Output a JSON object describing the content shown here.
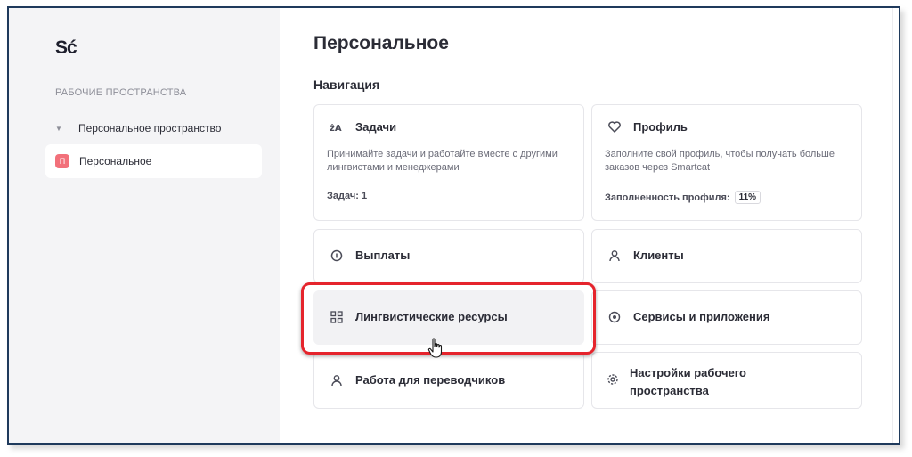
{
  "sidebar": {
    "logo": "Sć",
    "workspaces_header": "РАБОЧИЕ ПРОСТРАНСТВА",
    "group_label": "Персональное пространство",
    "group_caret": "▼",
    "active_item": {
      "badge": "П",
      "label": "Персональное"
    }
  },
  "main": {
    "title": "Персональное",
    "nav_heading": "Навигация",
    "cards": {
      "tasks": {
        "icon": "translate-icon",
        "title": "Задачи",
        "description": "Принимайте задачи и работайте вместе с другими лингвистами и менеджерами",
        "footer": "Задач: 1"
      },
      "profile": {
        "icon": "heart-icon",
        "title": "Профиль",
        "description": "Заполните свой профиль, чтобы получать больше заказов через Smartcat",
        "footer_label": "Заполненность профиля:",
        "footer_value": "11%"
      },
      "payouts": {
        "icon": "coin-icon",
        "title": "Выплаты"
      },
      "clients": {
        "icon": "user-icon",
        "title": "Клиенты"
      },
      "linguistic": {
        "icon": "grid-icon",
        "title": "Лингвистические ресурсы"
      },
      "services": {
        "icon": "target-icon",
        "title": "Сервисы и приложения"
      },
      "translators": {
        "icon": "user-icon",
        "title": "Работа для переводчиков"
      },
      "settings": {
        "icon": "gear-icon",
        "title": "Настройки рабочего пространства"
      }
    }
  },
  "colors": {
    "highlight": "#e5242c",
    "badge": "#f2707a",
    "sidebar_bg": "#f4f4f6"
  }
}
